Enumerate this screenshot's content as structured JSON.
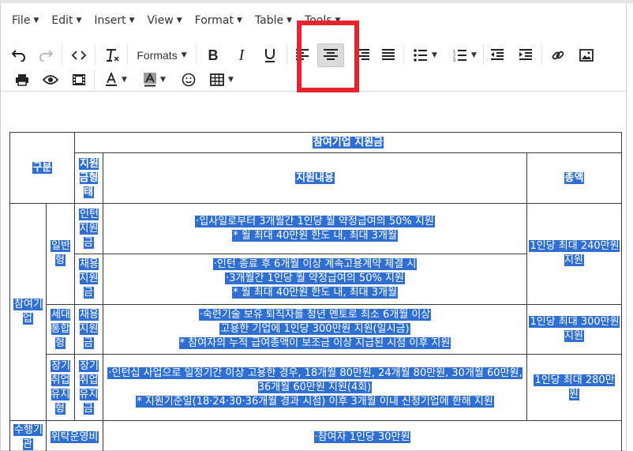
{
  "menubar": {
    "items": [
      {
        "label": "File"
      },
      {
        "label": "Edit"
      },
      {
        "label": "Insert"
      },
      {
        "label": "View"
      },
      {
        "label": "Format"
      },
      {
        "label": "Table"
      },
      {
        "label": "Tools"
      }
    ]
  },
  "toolbar": {
    "formats_label": "Formats"
  },
  "colors": {
    "highlight_box": "#e8232c",
    "selection": "#2f6fd2"
  },
  "table": {
    "header": {
      "category": "구분",
      "support_type": "지원금형태",
      "title": "참여기업 지원금",
      "content": "지원내용",
      "total": "총액"
    },
    "rows": {
      "participant_label": "참여기업",
      "general_label": "일반형",
      "intern_type": "인턴지원금",
      "intern_lines": [
        "·입사일로부터 3개월간 1인당 월 약정급여의 50% 지원",
        "* 월 최대 40만원 한도 내, 최대 3개월"
      ],
      "intern_total": "1인당 최대 240만원 지원",
      "hire_type": "채용지원금",
      "hire_lines": [
        "·인턴 종료 후 6개월 이상 계속고용계약 체결 시",
        "·3개월간 1인당 월 약정급여의 50% 지원",
        "* 월 최대 40만원 한도 내, 최대 3개월"
      ],
      "gen_label": "세대통합형",
      "gen_type": "채용지원금",
      "gen_lines": [
        "·숙련기술 보유 퇴직자를 청년 멘토로 최소 6개월 이상",
        "고용한 기업에 1인당 300만원 지원(일시금)",
        "* 참여자의 누적 급여총액이 보조금 이상 지급된 시점 이후 지원"
      ],
      "gen_total": "1인당 최대 300만원 지원",
      "long_label": "장기취업유지형",
      "long_type": "장기취업유지금",
      "long_lines": [
        "·인턴십 사업으로 일정기간 이상 고용한 경우, 18개월 80만원, 24개월 80만원, 30개월 60만원, 36개월 60만원 지원(4회)",
        "* 지원기준일(18·24·30·36개월 경과 시점) 이후 3개월 이내 신청기업에 한해 지원"
      ],
      "long_total": "1인당 최대 280만원",
      "agency_label": "수행기관",
      "agency_type": "위탁운영비",
      "agency_content": "·참여자 1인당 30만원"
    }
  }
}
